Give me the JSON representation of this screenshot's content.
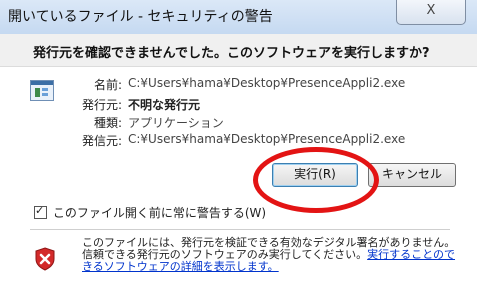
{
  "window": {
    "title": "開いているファイル - セキュリティの警告",
    "close_label": "X"
  },
  "dialog": {
    "question": "発行元を確認できませんでした。このソフトウェアを実行しますか?",
    "fields": [
      {
        "label": "名前:",
        "value": "C:¥Users¥hama¥Desktop¥PresenceAppli2.exe"
      },
      {
        "label": "発行元:",
        "value": "不明な発行元"
      },
      {
        "label": "種類:",
        "value": "アプリケーション"
      },
      {
        "label": "発信元:",
        "value": "C:¥Users¥hama¥Desktop¥PresenceAppli2.exe"
      }
    ],
    "run_button": "実行(R)",
    "cancel_button": "キャンセル",
    "checkbox_label": "このファイル開く前に常に警告する(W)",
    "checkbox_checked": true,
    "warning_text": "このファイルには、発行元を検証できる有効なデジタル署名がありません。信頼できる発行元のソフトウェアのみ実行してください。",
    "warning_link": "実行することのできるソフトウェアの詳細を表示します。",
    "highlight_color": "#e31414"
  }
}
